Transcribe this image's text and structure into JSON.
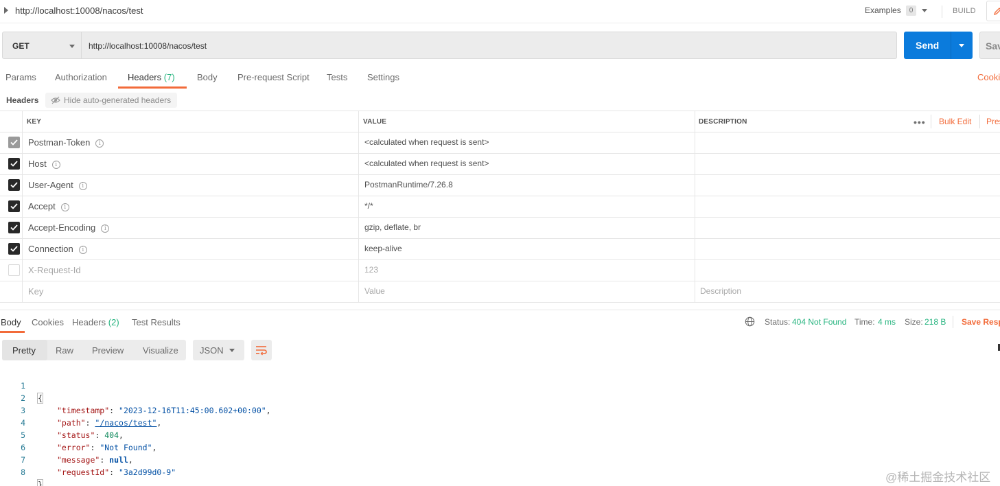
{
  "request": {
    "title": "http://localhost:10008/nacos/test",
    "examples_label": "Examples",
    "examples_count": "0",
    "build_label": "BUILD",
    "method": "GET",
    "url": "http://localhost:10008/nacos/test",
    "send_label": "Send",
    "save_label": "Save"
  },
  "request_tabs": [
    {
      "label": "Params"
    },
    {
      "label": "Authorization"
    },
    {
      "label": "Headers",
      "count": "(7)",
      "active": true
    },
    {
      "label": "Body"
    },
    {
      "label": "Pre-request Script"
    },
    {
      "label": "Tests"
    },
    {
      "label": "Settings"
    }
  ],
  "cookies_link": "Cookies",
  "headers_section": {
    "label": "Headers",
    "hide_auto_label": "Hide auto-generated headers"
  },
  "table": {
    "columns": {
      "key": "KEY",
      "value": "VALUE",
      "description": "DESCRIPTION"
    },
    "more_label": "•••",
    "bulk_edit": "Bulk Edit",
    "presets": "Presets",
    "rows": [
      {
        "key": "Postman-Token",
        "value": "<calculated when request is sent>",
        "checked": "dim"
      },
      {
        "key": "Host",
        "value": "<calculated when request is sent>",
        "checked": "on"
      },
      {
        "key": "User-Agent",
        "value": "PostmanRuntime/7.26.8",
        "checked": "on"
      },
      {
        "key": "Accept",
        "value": "*/*",
        "checked": "on"
      },
      {
        "key": "Accept-Encoding",
        "value": "gzip, deflate, br",
        "checked": "on"
      },
      {
        "key": "Connection",
        "value": "keep-alive",
        "checked": "on"
      },
      {
        "key": "X-Request-Id",
        "value": "123",
        "checked": "off"
      }
    ],
    "placeholders": {
      "key": "Key",
      "value": "Value",
      "description": "Description"
    }
  },
  "response_tabs": [
    {
      "label": "Body",
      "active": true
    },
    {
      "label": "Cookies"
    },
    {
      "label": "Headers",
      "count": "(2)"
    },
    {
      "label": "Test Results"
    }
  ],
  "response_status": {
    "status_label": "Status:",
    "status_value": "404 Not Found",
    "time_label": "Time:",
    "time_value": "4 ms",
    "size_label": "Size:",
    "size_value": "218 B",
    "save_response": "Save Response"
  },
  "view_modes": {
    "pretty": "Pretty",
    "raw": "Raw",
    "preview": "Preview",
    "visualize": "Visualize",
    "format": "JSON"
  },
  "code_lines": [
    {
      "num": "1",
      "brace": "{"
    },
    {
      "num": "2",
      "key": "\"timestamp\"",
      "value": "\"2023-12-16T11:45:00.602+00:00\"",
      "type": "string"
    },
    {
      "num": "3",
      "key": "\"path\"",
      "value": "\"/nacos/test\"",
      "type": "string"
    },
    {
      "num": "4",
      "key": "\"status\"",
      "value": "404",
      "type": "number"
    },
    {
      "num": "5",
      "key": "\"error\"",
      "value": "\"Not Found\"",
      "type": "string"
    },
    {
      "num": "6",
      "key": "\"message\"",
      "value": "null",
      "type": "keyword"
    },
    {
      "num": "7",
      "key": "\"requestId\"",
      "value": "\"3a2d99d0-9\"",
      "type": "string"
    },
    {
      "num": "8",
      "brace": "}"
    }
  ],
  "watermark": "@稀土掘金技术社区",
  "colors": {
    "accent": "#f26b3a",
    "send": "#0b7bdc",
    "status_green": "#26b47f"
  }
}
